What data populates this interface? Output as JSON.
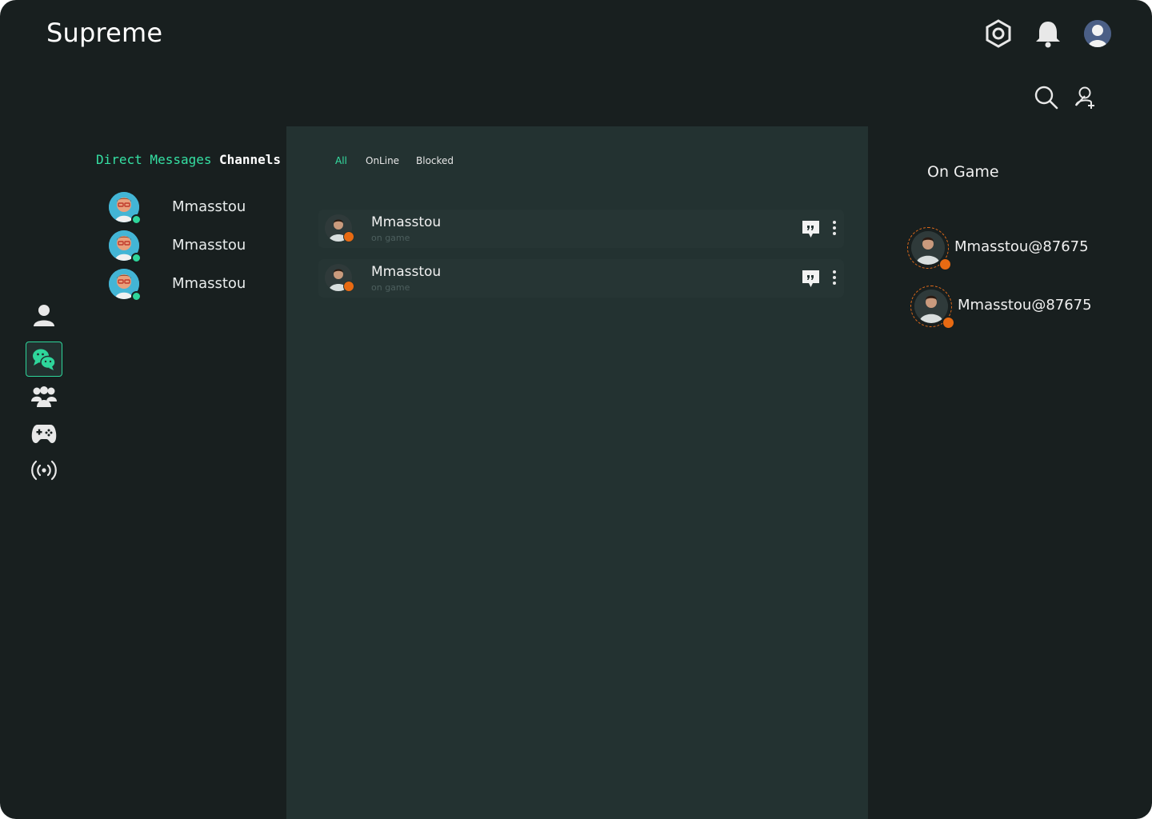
{
  "app": {
    "title": "Supreme"
  },
  "header": {
    "icons": [
      "settings-hex-icon",
      "bell-icon",
      "profile-avatar"
    ],
    "actions": [
      "search-icon",
      "add-friend-icon"
    ]
  },
  "nav": {
    "items": [
      {
        "name": "profile-icon",
        "active": false
      },
      {
        "name": "chat-icon",
        "active": true
      },
      {
        "name": "group-icon",
        "active": false
      },
      {
        "name": "gamepad-icon",
        "active": false
      },
      {
        "name": "broadcast-icon",
        "active": false
      }
    ]
  },
  "sidebar": {
    "tabs": [
      {
        "label": "Direct Messages",
        "active": true
      },
      {
        "label": "Channels",
        "active": false
      }
    ],
    "direct_messages": [
      {
        "name": "Mmasstou"
      },
      {
        "name": "Mmasstou"
      },
      {
        "name": "Mmasstou"
      }
    ]
  },
  "main": {
    "filters": [
      {
        "label": "All",
        "active": true
      },
      {
        "label": "OnLine",
        "active": false
      },
      {
        "label": "Blocked",
        "active": false
      }
    ],
    "friends": [
      {
        "name": "Mmasstou",
        "status": "on game"
      },
      {
        "name": "Mmasstou",
        "status": "on game"
      }
    ]
  },
  "on_game": {
    "title": "On Game",
    "players": [
      {
        "name": "Mmasstou@87675"
      },
      {
        "name": "Mmasstou@87675"
      }
    ]
  },
  "colors": {
    "accent": "#35e0a3",
    "game_badge": "#e86a12",
    "bg": "#181f1f",
    "panel": "#233231"
  }
}
